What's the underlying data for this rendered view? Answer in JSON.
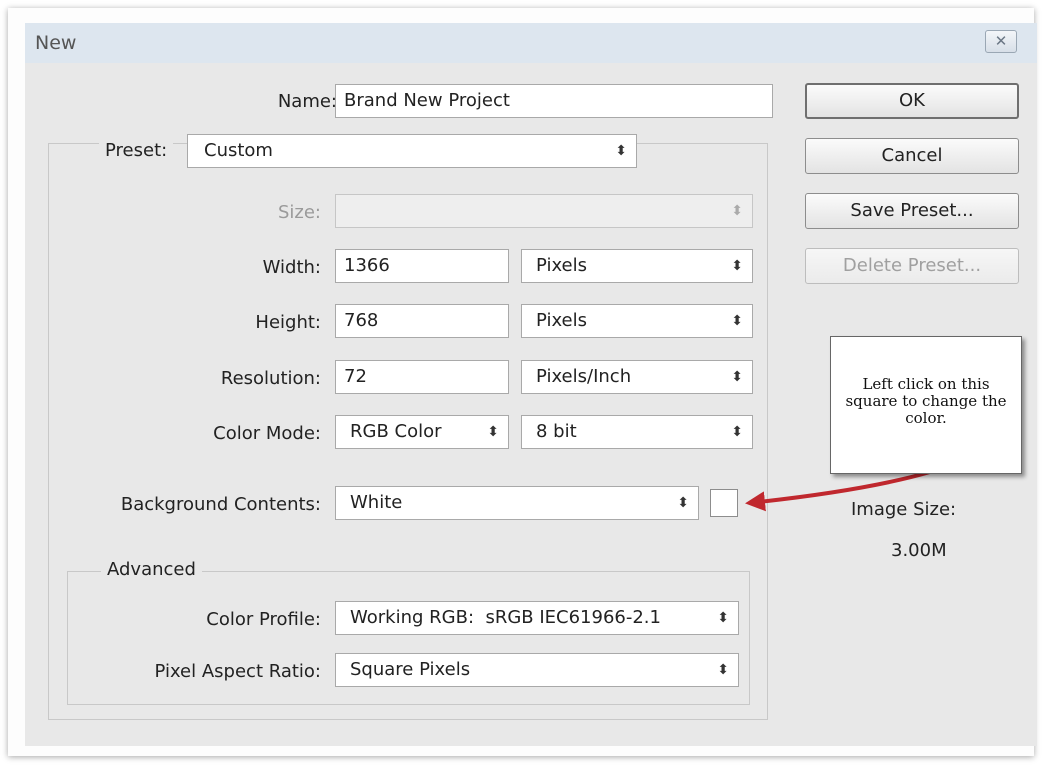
{
  "dialog": {
    "title": "New"
  },
  "form": {
    "name_label": "Name:",
    "name_value": "Brand New Project",
    "preset_label": "Preset:",
    "preset_value": "Custom",
    "size_label": "Size:",
    "size_value": "",
    "width_label": "Width:",
    "width_value": "1366",
    "width_unit": "Pixels",
    "height_label": "Height:",
    "height_value": "768",
    "height_unit": "Pixels",
    "resolution_label": "Resolution:",
    "resolution_value": "72",
    "resolution_unit": "Pixels/Inch",
    "color_mode_label": "Color Mode:",
    "color_mode_value": "RGB Color",
    "bit_depth_value": "8 bit",
    "background_label": "Background Contents:",
    "background_value": "White",
    "background_swatch_color": "#ffffff"
  },
  "advanced": {
    "legend": "Advanced",
    "color_profile_label": "Color Profile:",
    "color_profile_value": "Working RGB:  sRGB IEC61966-2.1",
    "pixel_aspect_label": "Pixel Aspect Ratio:",
    "pixel_aspect_value": "Square Pixels"
  },
  "buttons": {
    "ok": "OK",
    "cancel": "Cancel",
    "save_preset": "Save Preset...",
    "delete_preset": "Delete Preset..."
  },
  "info": {
    "image_size_label": "Image Size:",
    "image_size_value": "3.00M"
  },
  "annotation": {
    "callout_text": "Left click on this square to change the color.",
    "arrow_color": "#c0282e"
  },
  "icons": {
    "close": "close-icon",
    "dropdown": "up-down-arrows-icon"
  }
}
